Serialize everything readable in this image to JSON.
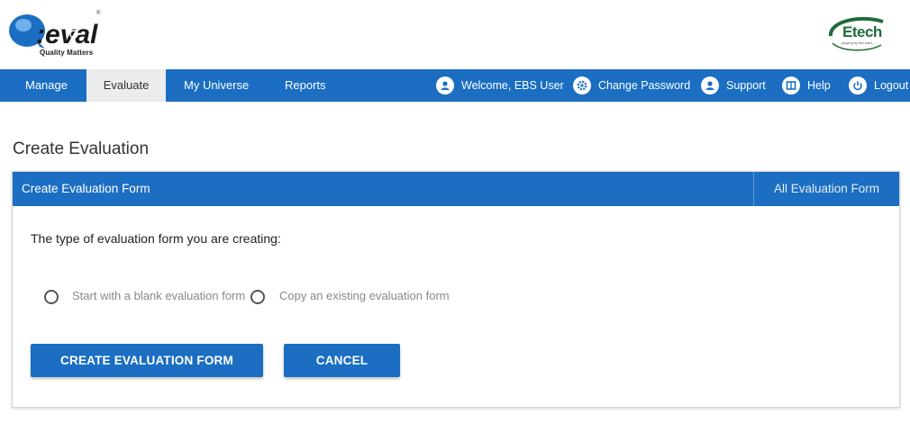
{
  "brand": {
    "logo_text": "Q-eval",
    "tagline": "Quality Matters",
    "partner_logo_text": "Etech",
    "partner_tagline": "playing by the rules"
  },
  "nav": {
    "items": [
      {
        "label": "Manage"
      },
      {
        "label": "Evaluate"
      },
      {
        "label": "My Universe"
      },
      {
        "label": "Reports"
      }
    ],
    "active": "Evaluate"
  },
  "utility": {
    "welcome": "Welcome, EBS User",
    "change_password": "Change Password",
    "support": "Support",
    "help": "Help",
    "logout": "Logout"
  },
  "page": {
    "title": "Create Evaluation"
  },
  "panel": {
    "title": "Create Evaluation Form",
    "link": "All Evaluation Form",
    "question": "The type of evaluation form you are creating:",
    "options": [
      {
        "label": "Start with a blank evaluation form",
        "selected": false
      },
      {
        "label": "Copy an existing evaluation form",
        "selected": false
      }
    ],
    "buttons": {
      "create": "CREATE EVALUATION FORM",
      "cancel": "CANCEL"
    }
  },
  "colors": {
    "primary": "#1b6ec2",
    "active_tab_bg": "#ececec",
    "muted_text": "#888888"
  }
}
